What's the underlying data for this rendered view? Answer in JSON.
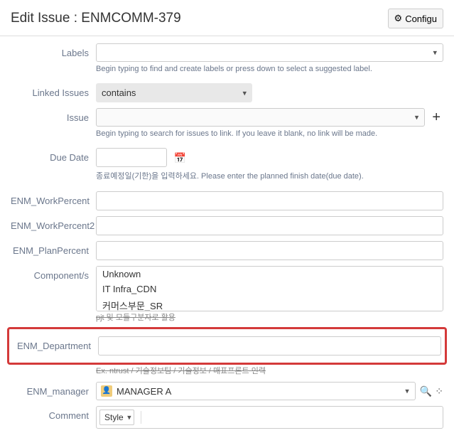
{
  "header": {
    "title": "Edit Issue : ENMCOMM-379",
    "configure_label": "Configu"
  },
  "labels_field": {
    "label": "Labels",
    "hint": "Begin typing to find and create labels or press down to select a suggested label."
  },
  "linked_issues": {
    "label": "Linked Issues",
    "value": "contains"
  },
  "issue": {
    "label": "Issue",
    "hint": "Begin typing to search for issues to link. If you leave it blank, no link will be made."
  },
  "due_date": {
    "label": "Due Date",
    "hint": "종료예정일(기한)을 입력하세요. Please enter the planned finish date(due date)."
  },
  "work_percent": {
    "label": "ENM_WorkPercent"
  },
  "work_percent2": {
    "label": "ENM_WorkPercent2"
  },
  "plan_percent": {
    "label": "ENM_PlanPercent"
  },
  "components": {
    "label": "Component/s",
    "opt1": "Unknown",
    "opt2": "IT Infra_CDN",
    "opt3": "커머스부문_SR",
    "hint": "pjt 및 모듈구분자로 활용"
  },
  "department": {
    "label": "ENM_Department",
    "hint": "Ex. ntrust / 기술정보팀 / 기술정보 / 매표프론트 인력"
  },
  "manager": {
    "label": "ENM_manager",
    "value": "MANAGER A"
  },
  "comment": {
    "label": "Comment",
    "style_label": "Style"
  }
}
